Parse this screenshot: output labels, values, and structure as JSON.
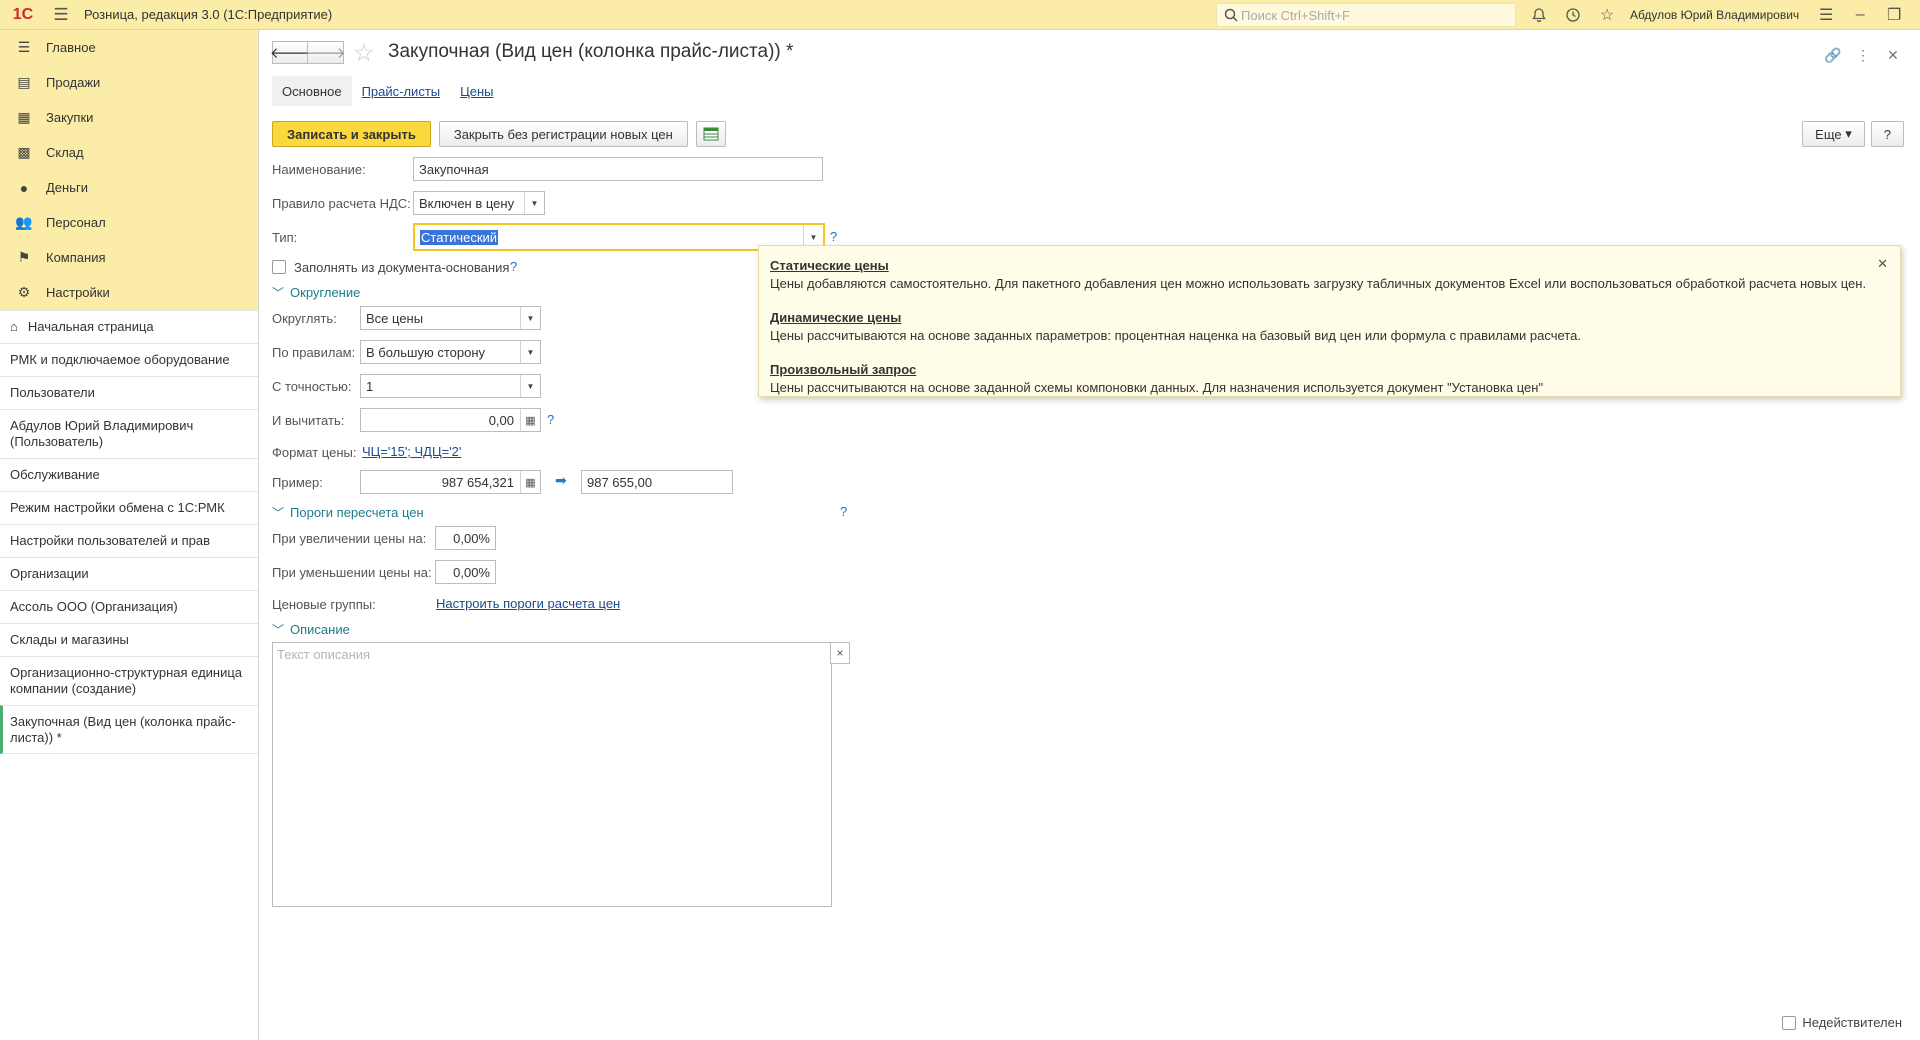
{
  "app": {
    "logo": "1С",
    "title": "Розница, редакция 3.0  (1С:Предприятие)",
    "search_placeholder": "Поиск Ctrl+Shift+F",
    "user": "Абдулов Юрий Владимирович"
  },
  "sections": [
    {
      "label": "Главное",
      "icon": "menu-icon"
    },
    {
      "label": "Продажи",
      "icon": "basket-icon"
    },
    {
      "label": "Закупки",
      "icon": "cart-icon"
    },
    {
      "label": "Склад",
      "icon": "warehouse-icon"
    },
    {
      "label": "Деньги",
      "icon": "ruble-icon"
    },
    {
      "label": "Персонал",
      "icon": "people-icon"
    },
    {
      "label": "Компания",
      "icon": "flag-icon"
    },
    {
      "label": "Настройки",
      "icon": "gear-icon"
    }
  ],
  "open_windows": {
    "home": "Начальная страница",
    "items": [
      "РМК и подключаемое оборудование",
      "Пользователи",
      "Абдулов Юрий Владимирович (Пользователь)",
      "Обслуживание",
      "Режим настройки обмена с 1С:РМК",
      "Настройки пользователей и прав",
      "Организации",
      "Ассоль ООО (Организация)",
      "Склады и магазины",
      "Организационно-структурная единица компании (создание)",
      "Закупочная (Вид цен (колонка прайс-листа)) *"
    ]
  },
  "form": {
    "title": "Закупочная (Вид цен (колонка прайс-листа)) *",
    "tabs": [
      "Основное",
      "Прайс-листы",
      "Цены"
    ],
    "save_close": "Записать и закрыть",
    "close_no_reg": "Закрыть без регистрации новых цен",
    "more": "Еще",
    "help": "?",
    "name_label": "Наименование:",
    "name_value": "Закупочная",
    "vat_label": "Правило расчета НДС:",
    "vat_value": "Включен в цену",
    "type_label": "Тип:",
    "type_value": "Статический",
    "fill_label": "Заполнять из документа-основания",
    "rounding_group": "Округление",
    "round_label": "Округлять:",
    "round_value": "Все цены",
    "rule_label": "По правилам:",
    "rule_value": "В большую сторону",
    "precision_label": "С точностью:",
    "precision_value": "1",
    "subtract_label": "И вычитать:",
    "subtract_value": "0,00",
    "format_label": "Формат цены:",
    "format_value": "ЧЦ='15'; ЧДЦ='2'",
    "example_label": "Пример:",
    "example_from": "987 654,321",
    "example_to": "987 655,00",
    "thresholds_group": "Пороги пересчета цен",
    "increase_label": "При увеличении цены на:",
    "increase_value": "0,00%",
    "decrease_label": "При уменьшении цены на:",
    "decrease_value": "0,00%",
    "price_groups_label": "Ценовые группы:",
    "price_groups_link": "Настроить пороги расчета цен",
    "description_group": "Описание",
    "description_placeholder": "Текст описания",
    "inactive_label": "Недействителен"
  },
  "tooltip": {
    "items": [
      {
        "title": "Статические цены",
        "text": "Цены добавляются самостоятельно. Для пакетного добавления цен можно использовать загрузку табличных документов Excel или воспользоваться обработкой расчета новых цен."
      },
      {
        "title": "Динамические цены",
        "text": "Цены рассчитываются на основе заданных параметров: процентная наценка на базовый вид цен или формула с правилами расчета."
      },
      {
        "title": "Произвольный запрос",
        "text": "Цены рассчитываются на основе заданной схемы компоновки данных. Для назначения используется документ \"Установка цен\""
      }
    ]
  }
}
